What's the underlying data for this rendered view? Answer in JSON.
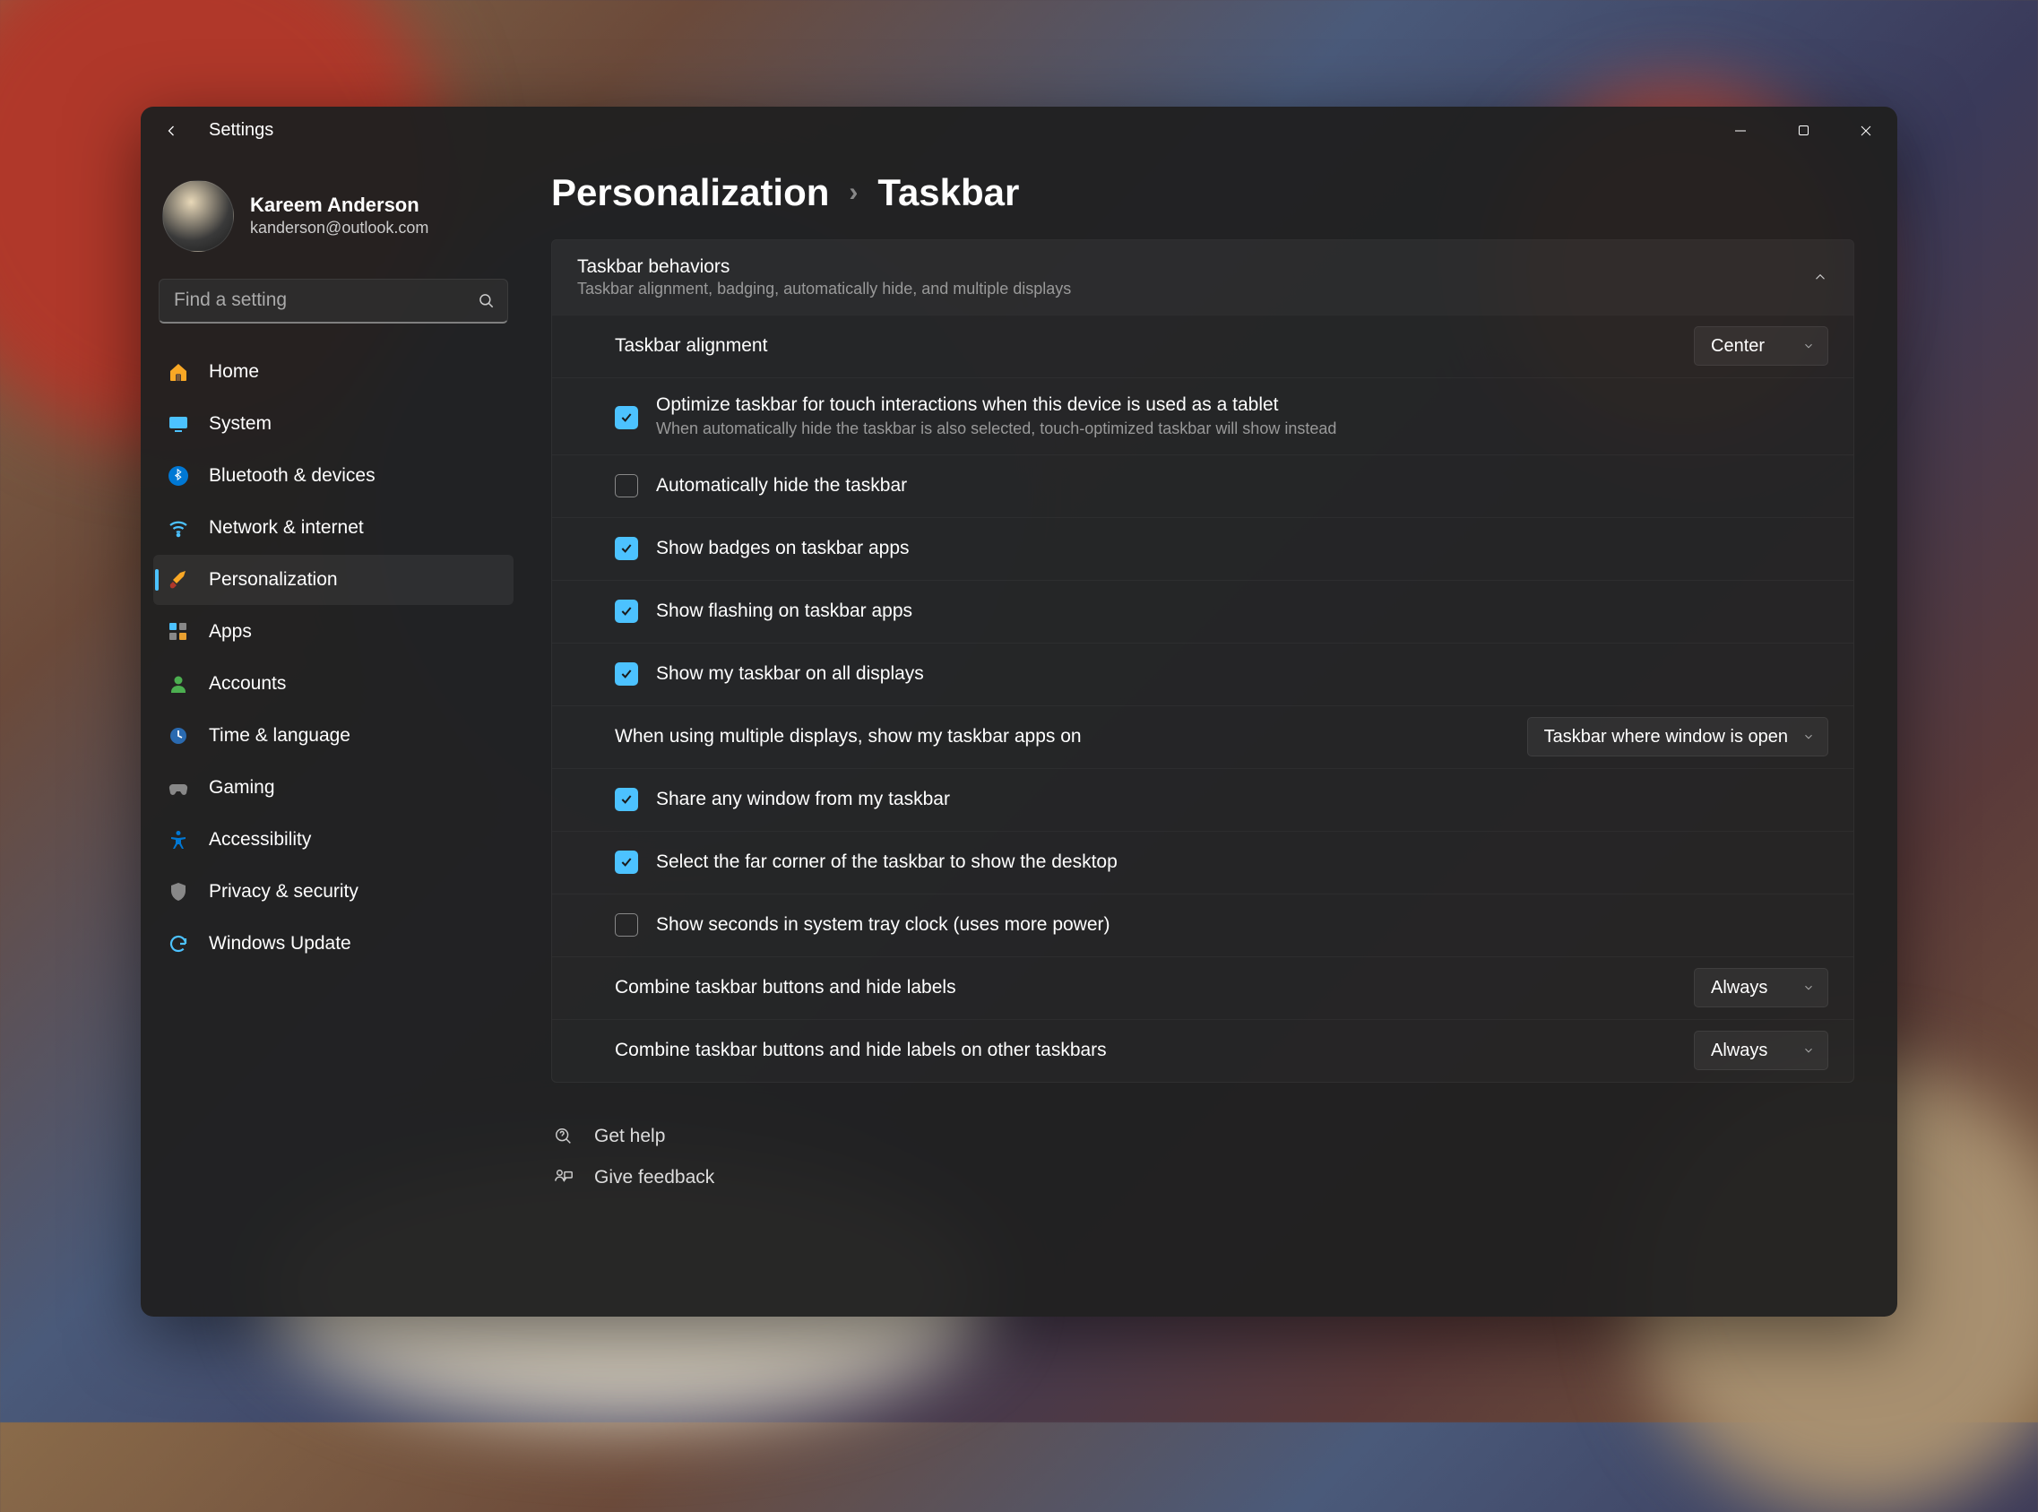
{
  "window": {
    "title": "Settings"
  },
  "user": {
    "name": "Kareem Anderson",
    "email": "kanderson@outlook.com"
  },
  "search": {
    "placeholder": "Find a setting"
  },
  "nav": {
    "items": [
      {
        "label": "Home"
      },
      {
        "label": "System"
      },
      {
        "label": "Bluetooth & devices"
      },
      {
        "label": "Network & internet"
      },
      {
        "label": "Personalization"
      },
      {
        "label": "Apps"
      },
      {
        "label": "Accounts"
      },
      {
        "label": "Time & language"
      },
      {
        "label": "Gaming"
      },
      {
        "label": "Accessibility"
      },
      {
        "label": "Privacy & security"
      },
      {
        "label": "Windows Update"
      }
    ]
  },
  "breadcrumb": {
    "parent": "Personalization",
    "current": "Taskbar"
  },
  "panel": {
    "title": "Taskbar behaviors",
    "subtitle": "Taskbar alignment, badging, automatically hide, and multiple displays"
  },
  "settings": {
    "alignment": {
      "label": "Taskbar alignment",
      "value": "Center"
    },
    "optimize_touch": {
      "label": "Optimize taskbar for touch interactions when this device is used as a tablet",
      "sub": "When automatically hide the taskbar is also selected, touch-optimized taskbar will show instead",
      "checked": true
    },
    "auto_hide": {
      "label": "Automatically hide the taskbar",
      "checked": false
    },
    "badges": {
      "label": "Show badges on taskbar apps",
      "checked": true
    },
    "flashing": {
      "label": "Show flashing on taskbar apps",
      "checked": true
    },
    "all_displays": {
      "label": "Show my taskbar on all displays",
      "checked": true
    },
    "multi_display_apps": {
      "label": "When using multiple displays, show my taskbar apps on",
      "value": "Taskbar where window is open"
    },
    "share_window": {
      "label": "Share any window from my taskbar",
      "checked": true
    },
    "far_corner": {
      "label": "Select the far corner of the taskbar to show the desktop",
      "checked": true
    },
    "show_seconds": {
      "label": "Show seconds in system tray clock (uses more power)",
      "checked": false
    },
    "combine": {
      "label": "Combine taskbar buttons and hide labels",
      "value": "Always"
    },
    "combine_other": {
      "label": "Combine taskbar buttons and hide labels on other taskbars",
      "value": "Always"
    }
  },
  "footer": {
    "help": "Get help",
    "feedback": "Give feedback"
  }
}
